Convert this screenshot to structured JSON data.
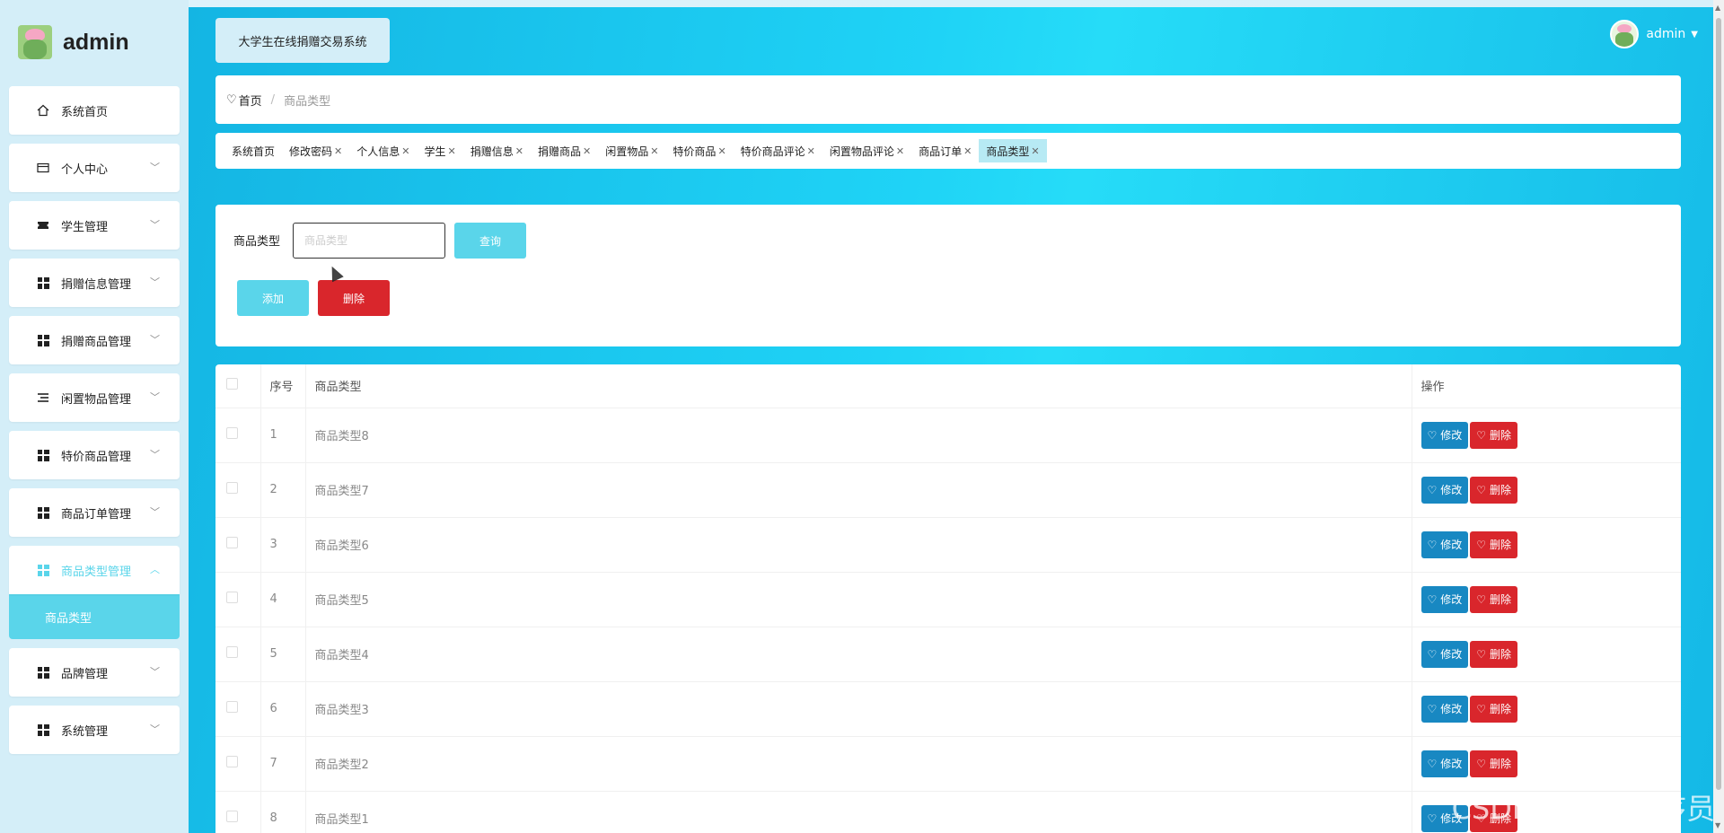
{
  "brand": {
    "name": "admin"
  },
  "system_title": "大学生在线捐赠交易系统",
  "user": {
    "name": "admin"
  },
  "sidebar": {
    "items": [
      {
        "label": "系统首页",
        "icon": "home-icon"
      },
      {
        "label": "个人中心",
        "icon": "card-icon"
      },
      {
        "label": "学生管理",
        "icon": "ticket-icon"
      },
      {
        "label": "捐赠信息管理",
        "icon": "grid-icon"
      },
      {
        "label": "捐赠商品管理",
        "icon": "grid-icon"
      },
      {
        "label": "闲置物品管理",
        "icon": "list-icon"
      },
      {
        "label": "特价商品管理",
        "icon": "grid-icon"
      },
      {
        "label": "商品订单管理",
        "icon": "grid-icon"
      },
      {
        "label": "商品类型管理",
        "icon": "grid-icon"
      },
      {
        "label": "品牌管理",
        "icon": "grid-icon"
      },
      {
        "label": "系统管理",
        "icon": "grid-icon"
      }
    ],
    "submenu": {
      "label": "商品类型"
    }
  },
  "breadcrumb": {
    "home": "首页",
    "separator": "/",
    "current": "商品类型"
  },
  "tabs": [
    {
      "label": "系统首页"
    },
    {
      "label": "修改密码"
    },
    {
      "label": "个人信息"
    },
    {
      "label": "学生"
    },
    {
      "label": "捐赠信息"
    },
    {
      "label": "捐赠商品"
    },
    {
      "label": "闲置物品"
    },
    {
      "label": "特价商品"
    },
    {
      "label": "特价商品评论"
    },
    {
      "label": "闲置物品评论"
    },
    {
      "label": "商品订单"
    },
    {
      "label": "商品类型"
    }
  ],
  "search": {
    "label": "商品类型",
    "placeholder": "商品类型",
    "query_button": "查询",
    "add_button": "添加",
    "delete_button": "删除"
  },
  "table": {
    "headers": {
      "index": "序号",
      "type": "商品类型",
      "actions": "操作"
    },
    "rows": [
      {
        "index": "1",
        "type": "商品类型8"
      },
      {
        "index": "2",
        "type": "商品类型7"
      },
      {
        "index": "3",
        "type": "商品类型6"
      },
      {
        "index": "4",
        "type": "商品类型5"
      },
      {
        "index": "5",
        "type": "商品类型4"
      },
      {
        "index": "6",
        "type": "商品类型3"
      },
      {
        "index": "7",
        "type": "商品类型2"
      },
      {
        "index": "8",
        "type": "商品类型1"
      }
    ],
    "edit_label": "修改",
    "delete_label": "删除"
  },
  "watermark": "CSDN @毕业程序员",
  "colors": {
    "accent": "#5ad5ea",
    "danger": "#d9262c",
    "edit": "#1888c2"
  }
}
